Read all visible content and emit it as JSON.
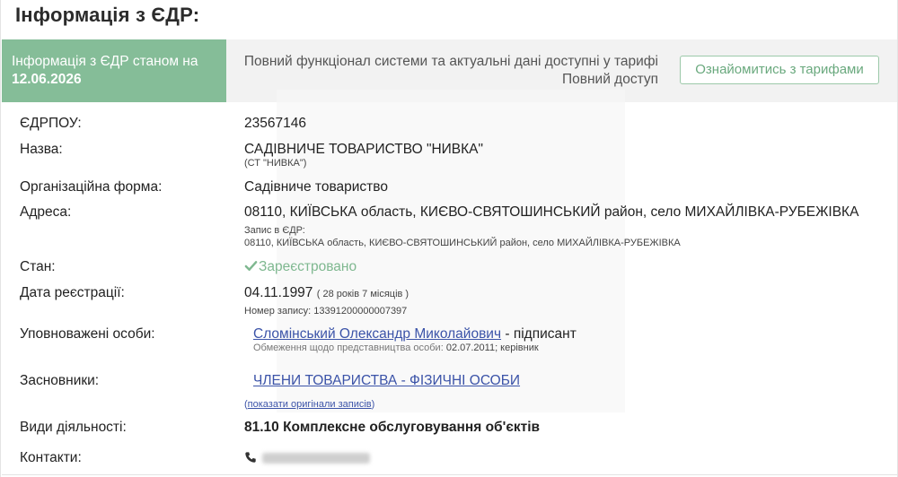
{
  "title": "Інформація з ЄДР:",
  "info_box": {
    "prefix": "Інформація з ЄДР станом на",
    "date": "12.06.2026"
  },
  "promo": {
    "text": "Повний функціонал системи та актуальні дані доступні у тарифі Повний доступ",
    "button_label": "Ознайомитись з тарифами"
  },
  "fields": {
    "edrpou": {
      "label": "ЄДРПОУ:",
      "value": "23567146"
    },
    "name": {
      "label": "Назва:",
      "value": "САДІВНИЧЕ ТОВАРИСТВО \"НИВКА\"",
      "short": "(СТ \"НИВКА\")"
    },
    "org_form": {
      "label": "Організаційна форма:",
      "value": "Садівниче товариство"
    },
    "address": {
      "label": "Адреса:",
      "value": "08110, КИЇВСЬКА область, КИЄВО-СВЯТОШИНСЬКИЙ район, село МИХАЙЛІВКА-РУБЕЖІВКА",
      "record_label": "Запис в ЄДР:",
      "record_value": "08110, КИЇВСЬКА область, КИЄВО-СВЯТОШИНСЬКИЙ район, село МИХАЙЛІВКА-РУБЕЖІВКА"
    },
    "state": {
      "label": "Стан:",
      "value": "Зареєстровано"
    },
    "reg_date": {
      "label": "Дата реєстрації:",
      "value": "04.11.1997",
      "duration": "( 28 років 7 місяців )",
      "record_no_label": "Номер запису:",
      "record_no": "1339120000000739​7"
    },
    "authorized": {
      "label": "Уповноважені особи:",
      "person": "Сломінський Олександр Миколайович",
      "role": "- підписант",
      "restriction_label": "Обмеження щодо представництва особи:",
      "restriction_value": "02.07.2011; керівник"
    },
    "founders": {
      "label": "Засновники:",
      "value": "ЧЛЕНИ ТОВАРИСТВА - ФІЗИЧНІ ОСОБИ",
      "show_original_open": "(",
      "show_original": "показати оригінали записів",
      "show_original_close": ")"
    },
    "activities": {
      "label": "Види діяльності:",
      "value": "81.10 Комплексне обслуговування об'єктів"
    },
    "contacts": {
      "label": "Контакти:"
    }
  },
  "colors": {
    "green": "#85bd98",
    "link": "#3b53a8",
    "status": "#7fb890"
  },
  "icons": {
    "status": "check-icon",
    "contacts": "phone-icon"
  }
}
